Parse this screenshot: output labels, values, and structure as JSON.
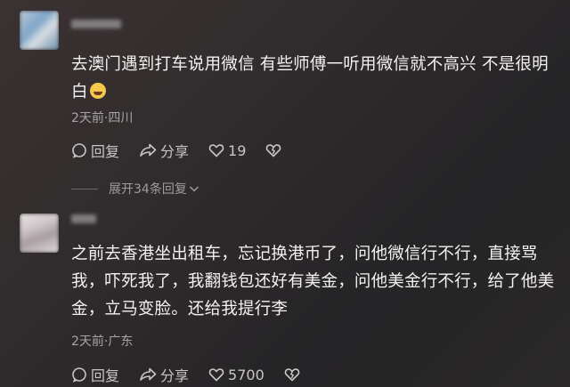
{
  "comments": [
    {
      "text": "去澳门遇到打车说用微信 有些师傅一听用微信就不高兴 不是很明白",
      "emoji": "grinning-sweat-emoji",
      "meta": "2天前·四川",
      "reply_label": "回复",
      "share_label": "分享",
      "like_count": "19",
      "expand_replies": "展开34条回复"
    },
    {
      "text": "之前去香港坐出租车，忘记换港币了，问他微信行不行，直接骂我，吓死我了，我翻钱包还好有美金，问他美金行不行，给了他美金，立马变脸。还给我提行李",
      "meta": "2天前·广东",
      "reply_label": "回复",
      "share_label": "分享",
      "like_count": "5700"
    }
  ],
  "colors": {
    "background": "#2f2b2c",
    "text": "#f4f1f1",
    "meta": "#a8a3a4",
    "action": "#c9c5c6"
  },
  "icons": [
    "reply-icon",
    "share-icon",
    "like-icon",
    "dislike-icon",
    "chevron-down-icon"
  ]
}
